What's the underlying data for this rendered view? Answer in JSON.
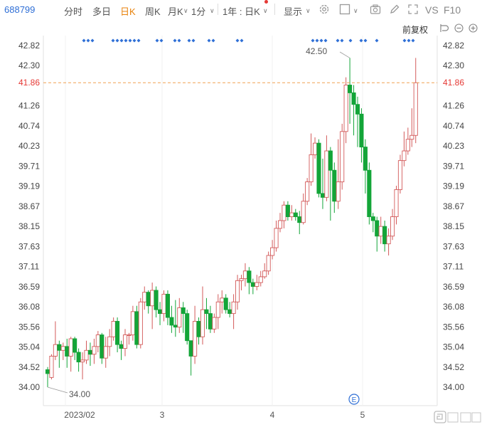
{
  "toolbar": {
    "stock_code": "688799",
    "tab_intraday": "分时",
    "tab_multiday": "多日",
    "tab_daily": "日K",
    "tab_weekly": "周K",
    "tab_monthly": "月K",
    "tab_minute": "1分",
    "range_selector": "1年 : 日K",
    "display_menu": "显示",
    "vs_button": "VS",
    "f10_button": "F10",
    "icons": [
      "settings-icon",
      "square-checkbox-icon",
      "camera-icon",
      "pen-icon",
      "expand-icon"
    ]
  },
  "subbar": {
    "adjust_label": "前复权",
    "icons": [
      "undo-icon",
      "zoom-out-icon",
      "zoom-in-icon"
    ]
  },
  "colors": {
    "up": "#d35a5a",
    "down": "#13a538",
    "reference_line": "#f0a050",
    "marker": "#2f6fd6",
    "active_tab": "#e8820c"
  },
  "chart_data": {
    "type": "candlestick",
    "y_ticks": [
      "42.82",
      "42.30",
      "41.86",
      "41.26",
      "40.74",
      "40.23",
      "39.71",
      "39.19",
      "38.67",
      "38.15",
      "37.63",
      "37.11",
      "36.59",
      "36.08",
      "35.56",
      "35.04",
      "34.52",
      "34.00"
    ],
    "ylim": [
      34.0,
      42.82
    ],
    "x_labels": [
      "2023/02",
      "3",
      "4",
      "5"
    ],
    "reference_price": "41.86",
    "max_label": "42.50",
    "min_label": "34.00",
    "event_marker": "E",
    "candles": [
      [
        34.45,
        34.35,
        34.52,
        34.0
      ],
      [
        34.25,
        34.8,
        34.85,
        34.2
      ],
      [
        34.8,
        35.1,
        35.7,
        34.7
      ],
      [
        35.1,
        34.95,
        35.2,
        34.5
      ],
      [
        34.95,
        35.05,
        35.15,
        34.7
      ],
      [
        35.05,
        34.8,
        35.25,
        34.5
      ],
      [
        34.8,
        35.25,
        35.3,
        34.4
      ],
      [
        35.25,
        34.9,
        35.3,
        34.7
      ],
      [
        34.9,
        34.65,
        35.0,
        34.4
      ],
      [
        34.65,
        34.7,
        34.9,
        34.2
      ],
      [
        34.7,
        34.95,
        35.2,
        34.6
      ],
      [
        34.95,
        34.85,
        35.15,
        34.55
      ],
      [
        34.85,
        35.05,
        35.25,
        34.6
      ],
      [
        35.05,
        35.35,
        35.45,
        34.9
      ],
      [
        35.35,
        34.75,
        35.4,
        34.6
      ],
      [
        34.75,
        35.05,
        35.3,
        34.5
      ],
      [
        35.05,
        35.3,
        35.5,
        34.8
      ],
      [
        35.3,
        35.7,
        35.8,
        35.2
      ],
      [
        35.7,
        35.1,
        35.8,
        34.9
      ],
      [
        35.1,
        35.0,
        35.2,
        34.7
      ],
      [
        35.0,
        35.35,
        35.5,
        34.8
      ],
      [
        35.35,
        35.35,
        35.4,
        35.1
      ],
      [
        35.35,
        35.95,
        36.1,
        35.2
      ],
      [
        35.95,
        35.1,
        36.1,
        35.0
      ],
      [
        35.1,
        36.2,
        36.3,
        35.0
      ],
      [
        36.2,
        36.45,
        36.6,
        36.0
      ],
      [
        36.45,
        36.1,
        36.5,
        35.9
      ],
      [
        36.1,
        36.5,
        36.7,
        35.5
      ],
      [
        36.5,
        36.0,
        36.6,
        35.8
      ],
      [
        36.0,
        35.9,
        36.2,
        35.6
      ],
      [
        35.9,
        36.4,
        36.5,
        35.7
      ],
      [
        36.4,
        35.8,
        36.5,
        35.6
      ],
      [
        35.8,
        35.6,
        36.1,
        35.4
      ],
      [
        35.6,
        35.55,
        36.25,
        35.3
      ],
      [
        35.55,
        36.05,
        36.3,
        35.4
      ],
      [
        36.05,
        35.9,
        36.2,
        35.4
      ],
      [
        35.9,
        35.2,
        36.0,
        35.1
      ],
      [
        35.2,
        34.8,
        35.2,
        34.3
      ],
      [
        34.8,
        35.7,
        36.1,
        34.6
      ],
      [
        35.7,
        35.3,
        35.8,
        35.1
      ],
      [
        35.3,
        36.0,
        36.6,
        35.1
      ],
      [
        36.0,
        35.9,
        36.3,
        35.5
      ],
      [
        35.9,
        35.5,
        36.1,
        35.4
      ],
      [
        35.5,
        35.8,
        35.9,
        35.4
      ],
      [
        35.8,
        36.2,
        36.4,
        35.5
      ],
      [
        36.2,
        36.3,
        36.5,
        35.9
      ],
      [
        36.3,
        36.0,
        36.4,
        35.9
      ],
      [
        36.0,
        35.9,
        36.2,
        35.8
      ],
      [
        35.9,
        36.2,
        36.4,
        35.5
      ],
      [
        36.2,
        36.75,
        36.9,
        36.0
      ],
      [
        36.75,
        36.8,
        36.9,
        36.5
      ],
      [
        36.8,
        37.0,
        37.2,
        36.6
      ],
      [
        37.0,
        36.7,
        37.1,
        36.4
      ],
      [
        36.7,
        36.6,
        36.8,
        36.4
      ],
      [
        36.6,
        36.7,
        36.9,
        36.5
      ],
      [
        36.7,
        36.85,
        37.0,
        36.6
      ],
      [
        36.85,
        37.0,
        37.2,
        36.8
      ],
      [
        37.0,
        37.4,
        37.5,
        36.9
      ],
      [
        37.4,
        37.6,
        37.8,
        37.3
      ],
      [
        37.6,
        38.1,
        38.3,
        37.5
      ],
      [
        38.1,
        38.3,
        38.5,
        38.0
      ],
      [
        38.3,
        38.7,
        38.8,
        38.1
      ],
      [
        38.7,
        38.4,
        38.8,
        38.3
      ],
      [
        38.4,
        38.5,
        38.7,
        38.3
      ],
      [
        38.5,
        38.4,
        38.6,
        38.3
      ],
      [
        38.4,
        38.25,
        38.55,
        37.95
      ],
      [
        38.25,
        38.8,
        39.0,
        38.2
      ],
      [
        38.8,
        39.3,
        39.4,
        38.7
      ],
      [
        39.3,
        40.0,
        40.55,
        39.2
      ],
      [
        40.0,
        40.3,
        40.45,
        39.9
      ],
      [
        40.3,
        39.0,
        40.4,
        38.9
      ],
      [
        39.0,
        38.9,
        39.9,
        38.6
      ],
      [
        38.9,
        40.1,
        40.5,
        38.8
      ],
      [
        40.1,
        39.6,
        40.2,
        38.3
      ],
      [
        39.6,
        38.8,
        39.8,
        38.5
      ],
      [
        38.8,
        39.3,
        40.4,
        38.6
      ],
      [
        39.3,
        40.6,
        40.8,
        39.1
      ],
      [
        40.6,
        41.8,
        42.0,
        40.3
      ],
      [
        41.8,
        41.6,
        42.5,
        40.8
      ],
      [
        41.6,
        41.3,
        41.8,
        40.5
      ],
      [
        41.3,
        41.05,
        41.5,
        40.2
      ],
      [
        41.05,
        40.2,
        41.2,
        39.8
      ],
      [
        40.2,
        39.6,
        40.4,
        39.0
      ],
      [
        39.6,
        38.4,
        39.8,
        38.2
      ],
      [
        38.4,
        38.3,
        38.5,
        38.0
      ],
      [
        38.3,
        37.9,
        38.4,
        37.5
      ],
      [
        37.9,
        38.15,
        38.4,
        37.7
      ],
      [
        38.15,
        37.7,
        38.3,
        37.5
      ],
      [
        37.7,
        37.9,
        38.1,
        37.4
      ],
      [
        37.9,
        38.4,
        38.6,
        37.8
      ],
      [
        38.4,
        39.1,
        39.2,
        38.2
      ],
      [
        39.1,
        39.85,
        40.0,
        39.0
      ],
      [
        39.85,
        40.1,
        40.6,
        39.7
      ],
      [
        40.1,
        40.4,
        40.7,
        40.0
      ],
      [
        40.4,
        40.5,
        41.2,
        40.2
      ],
      [
        40.5,
        41.86,
        42.5,
        40.3
      ]
    ]
  }
}
